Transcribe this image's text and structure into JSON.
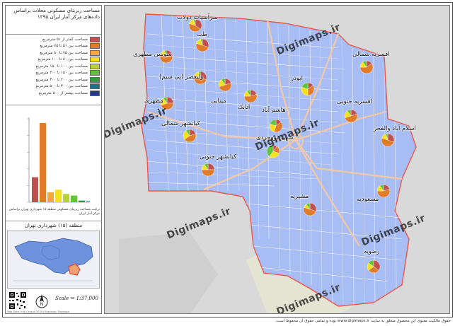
{
  "legend": {
    "title": "مساحت زیربنای مسکونی محلات براساس داده‌های مرکز آمار ایران ۱۳۹۵",
    "items": [
      {
        "label": "مساحت کمتر از ۵۱ مترمربع",
        "color": "#c0504d"
      },
      {
        "label": "مساحت بین ۵۱ تا ۷۵ مترمربع",
        "color": "#e07b2a"
      },
      {
        "label": "مساحت بین ۷۵ تا ۸۰ مترمربع",
        "color": "#f2a93b"
      },
      {
        "label": "مساحت بین ۸۰ تا ۱۰۰ مترمربع",
        "color": "#f4e01d"
      },
      {
        "label": "مساحت بین ۱۰۰ تا ۱۵۰ مترمربع",
        "color": "#b5d334"
      },
      {
        "label": "مساحت بین ۱۵۰ تا ۲۰۰ مترمربع",
        "color": "#5ec43a"
      },
      {
        "label": "مساحت بین ۲۰۰ تا ۳۰۰ مترمربع",
        "color": "#2e9b4a"
      },
      {
        "label": "مساحت بین ۳۰۰ تا ۵۰۰ مترمربع",
        "color": "#1f6f86"
      },
      {
        "label": "مساحت بیشتر از ۵۰۰ مترمربع",
        "color": "#1f3b8a"
      }
    ]
  },
  "histogram": {
    "caption": "ترکیب مساحت زیربنای مسکونی منطقه ۱۵ شهرداری تهران براساس مرکز آمار ایران",
    "bars": [
      {
        "value": 0.3,
        "color": "#c0504d"
      },
      {
        "value": 0.95,
        "color": "#e07b2a"
      },
      {
        "value": 0.12,
        "color": "#f2a93b"
      },
      {
        "value": 0.15,
        "color": "#f4e01d"
      },
      {
        "value": 0.1,
        "color": "#b5d334"
      },
      {
        "value": 0.08,
        "color": "#5ec43a"
      },
      {
        "value": 0.02,
        "color": "#2e9b4a"
      },
      {
        "value": 0.01,
        "color": "#1f6f86"
      },
      {
        "value": 0.01,
        "color": "#1f3b8a"
      }
    ]
  },
  "inset": {
    "title": "منطقه (۱۵) شهرداری تهران"
  },
  "scale": "Scale = 1:37,000",
  "source": "Map Data: Iran Census 2016 | Basemap: Digimaps",
  "neighborhoods": [
    {
      "name": "سرآسیاب دولاب",
      "pie": [
        0.35,
        0.45,
        0.15,
        0.05
      ]
    },
    {
      "name": "طب",
      "pie": [
        0.3,
        0.5,
        0.15,
        0.05
      ]
    },
    {
      "name": "سوسن مطهری",
      "pie": [
        0.25,
        0.55,
        0.15,
        0.05
      ]
    },
    {
      "name": "ولیعصر (پی سیم)",
      "pie": [
        0.3,
        0.5,
        0.15,
        0.05
      ]
    },
    {
      "name": "مطهری",
      "pie": [
        0.25,
        0.45,
        0.2,
        0.1
      ]
    },
    {
      "name": "مینایی",
      "pie": [
        0.2,
        0.5,
        0.2,
        0.1
      ]
    },
    {
      "name": "اتابک",
      "pie": [
        0.2,
        0.55,
        0.15,
        0.1
      ]
    },
    {
      "name": "ابوذر",
      "pie": [
        0.15,
        0.35,
        0.3,
        0.2
      ]
    },
    {
      "name": "افسریه شمالی",
      "pie": [
        0.15,
        0.6,
        0.15,
        0.1
      ]
    },
    {
      "name": "افسریه جنوبی",
      "pie": [
        0.2,
        0.5,
        0.2,
        0.1
      ]
    },
    {
      "name": "اسلام آباد والفجر",
      "pie": [
        0.3,
        0.5,
        0.15,
        0.05
      ]
    },
    {
      "name": "کیانشهر شمالی",
      "pie": [
        0.2,
        0.45,
        0.25,
        0.1
      ]
    },
    {
      "name": "هاشم آباد",
      "pie": [
        0.15,
        0.4,
        0.25,
        0.2
      ]
    },
    {
      "name": "شهید بروجردی",
      "pie": [
        0.1,
        0.2,
        0.3,
        0.4
      ]
    },
    {
      "name": "کیانشهر جنوبی",
      "pie": [
        0.25,
        0.5,
        0.15,
        0.1
      ]
    },
    {
      "name": "مسعودیه",
      "pie": [
        0.2,
        0.55,
        0.15,
        0.1
      ]
    },
    {
      "name": "مشیریه",
      "pie": [
        0.3,
        0.5,
        0.1,
        0.1
      ]
    },
    {
      "name": "رضویه",
      "pie": [
        0.35,
        0.3,
        0.2,
        0.15
      ]
    }
  ],
  "watermark": "Digimaps.ir",
  "footer": "حقوق مالکیت معنوی این محصول متعلق به سایت www.digimaps.ir بوده و تمامی حقوق آن محفوظ است."
}
